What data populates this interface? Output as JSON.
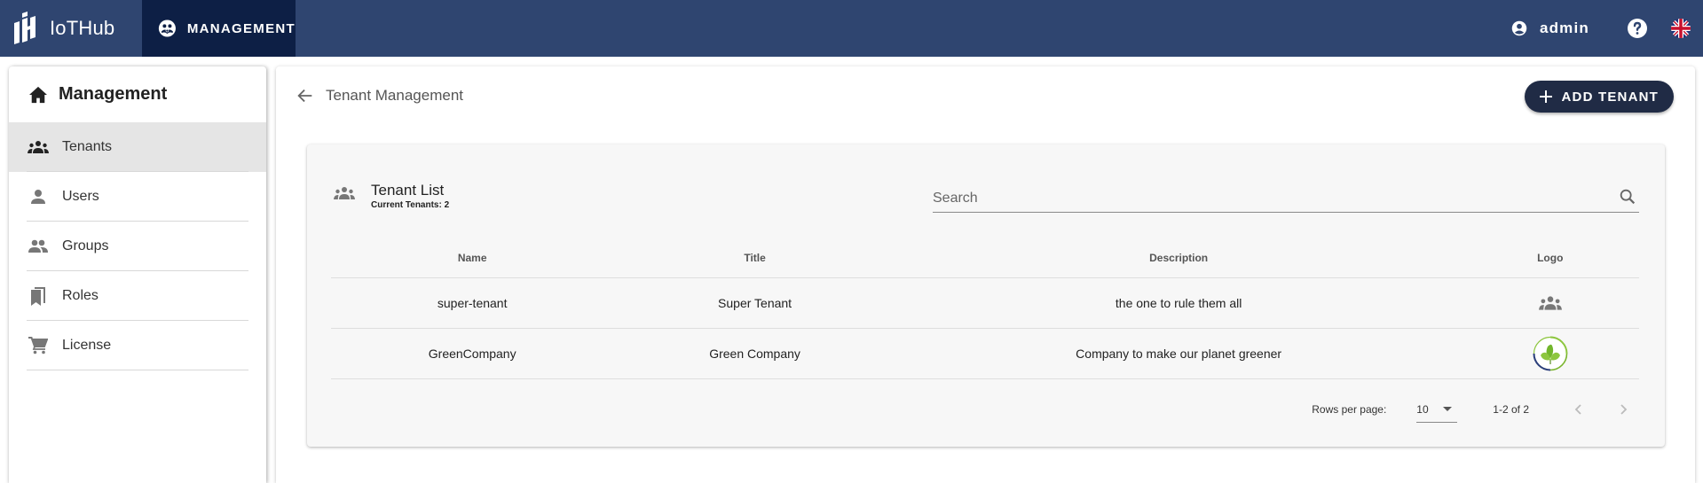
{
  "topbar": {
    "brand": "IoTHub",
    "nav_tab": {
      "label": "MANAGEMENT",
      "icon": "management-icon"
    },
    "user": {
      "name": "admin",
      "icon": "account-circle-icon"
    },
    "help_icon": "help-icon",
    "language_icon": "uk-flag-icon"
  },
  "sidebar": {
    "title": "Management",
    "title_icon": "home-icon",
    "items": [
      {
        "label": "Tenants",
        "icon": "groups-icon",
        "active": true
      },
      {
        "label": "Users",
        "icon": "person-icon",
        "active": false
      },
      {
        "label": "Groups",
        "icon": "people-icon",
        "active": false
      },
      {
        "label": "Roles",
        "icon": "bookmarks-icon",
        "active": false
      },
      {
        "label": "License",
        "icon": "cart-icon",
        "active": false
      }
    ]
  },
  "main": {
    "title": "Tenant Management",
    "add_button": "ADD TENANT",
    "card": {
      "title": "Tenant List",
      "subtitle": "Current Tenants: 2",
      "search": {
        "placeholder": "Search",
        "value": ""
      },
      "columns": [
        "Name",
        "Title",
        "Description",
        "Logo"
      ],
      "rows": [
        {
          "name": "super-tenant",
          "title": "Super Tenant",
          "description": "the one to rule them all",
          "logo": "groups-icon"
        },
        {
          "name": "GreenCompany",
          "title": "Green Company",
          "description": "Company to make our planet greener",
          "logo": "green-leaf-logo"
        }
      ],
      "pagination": {
        "rows_per_page_label": "Rows per page:",
        "rows_per_page": "10",
        "range": "1-2 of 2"
      }
    }
  },
  "colors": {
    "topbar": "#2f4570",
    "active_tab": "#0d1f45",
    "add_button": "#202b45",
    "card_bg": "#f7f7f7",
    "sidebar_active": "#e5e5e5"
  }
}
